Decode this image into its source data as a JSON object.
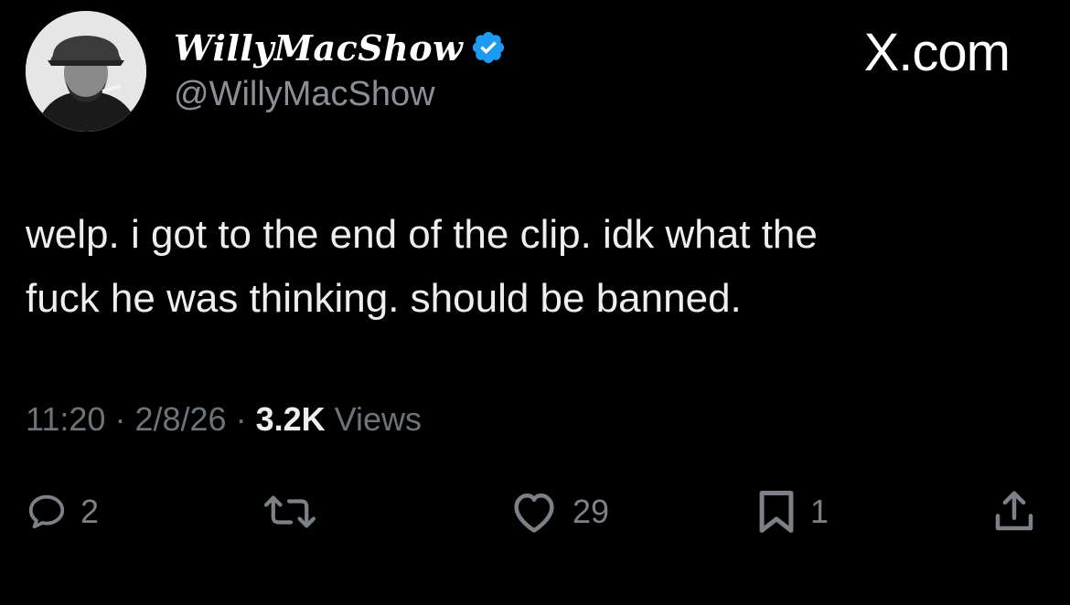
{
  "account": {
    "display_name": "WillyMacShow",
    "handle": "@WillyMacShow",
    "verified_icon": "verified-badge-icon",
    "avatar_icon": "avatar-photo",
    "verified_color": "#1d9bf0"
  },
  "brand": {
    "label": "X.com"
  },
  "tweet": {
    "text": "welp. i got to the end of the clip. idk what the\nfuck he was thinking. should be banned."
  },
  "meta": {
    "time": "11:20",
    "separator_1": "·",
    "date": "2/8/26",
    "separator_2": "·",
    "views_count": "3.2K",
    "views_label": "Views"
  },
  "actions": {
    "reply": {
      "icon": "reply-icon",
      "count": "2"
    },
    "repost": {
      "icon": "repost-icon",
      "count": ""
    },
    "like": {
      "icon": "heart-icon",
      "count": "29"
    },
    "bookmark": {
      "icon": "bookmark-icon",
      "count": "1"
    },
    "share": {
      "icon": "share-icon",
      "count": ""
    }
  },
  "colors": {
    "background": "#000000",
    "primary_text": "#e7e9ea",
    "secondary_text": "#6e7378",
    "accent": "#1d9bf0"
  }
}
